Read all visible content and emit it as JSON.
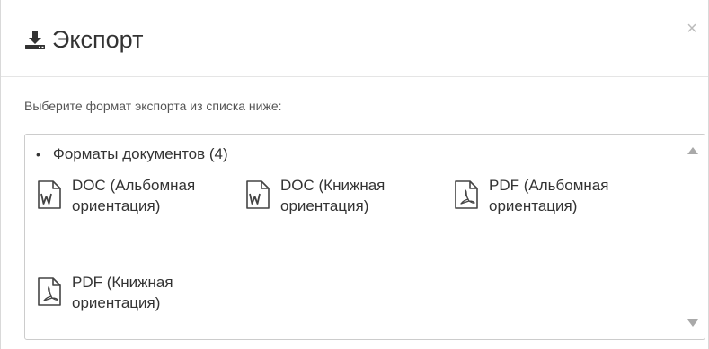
{
  "dialog": {
    "title": "Экспорт",
    "icon": "download-icon",
    "close_label": "×"
  },
  "instruction": "Выберите формат экспорта из списка ниже:",
  "group": {
    "bullet": "•",
    "title": "Форматы документов (4)"
  },
  "formats": [
    {
      "icon": "word-file-icon",
      "label": "DOC (Альбомная ориентация)"
    },
    {
      "icon": "word-file-icon",
      "label": "DOC (Книжная ориентация)"
    },
    {
      "icon": "pdf-file-icon",
      "label": "PDF (Альбомная ориентация)"
    },
    {
      "icon": "pdf-file-icon",
      "label": "PDF (Книжная ориентация)"
    }
  ],
  "scrollbar": {
    "up_icon": "arrow-up-icon",
    "down_icon": "arrow-down-icon"
  }
}
